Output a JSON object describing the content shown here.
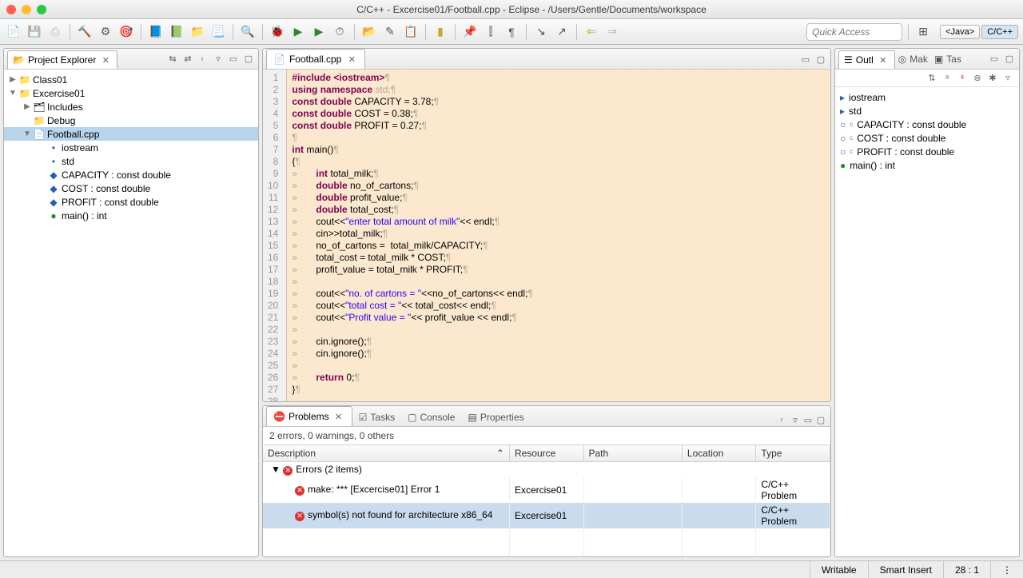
{
  "window": {
    "title": "C/C++ - Excercise01/Football.cpp - Eclipse - /Users/Gentle/Documents/workspace"
  },
  "quick_access": {
    "placeholder": "Quick Access"
  },
  "perspectives": {
    "java": "<Java>",
    "cpp": "C/C++"
  },
  "explorer": {
    "title": "Project Explorer",
    "items": [
      {
        "label": "Class01",
        "indent": 0,
        "arrow": "▶",
        "icon": "📁"
      },
      {
        "label": "Excercise01",
        "indent": 0,
        "arrow": "▼",
        "icon": "📁"
      },
      {
        "label": "Includes",
        "indent": 1,
        "arrow": "▶",
        "icon": "🗂"
      },
      {
        "label": "Debug",
        "indent": 1,
        "arrow": "",
        "icon": "📁"
      },
      {
        "label": "Football.cpp",
        "indent": 1,
        "arrow": "▼",
        "icon": "📄",
        "sel": true
      },
      {
        "label": "iostream",
        "indent": 2,
        "arrow": "",
        "icon": "•",
        "cls": "iblue"
      },
      {
        "label": "std",
        "indent": 2,
        "arrow": "",
        "icon": "•",
        "cls": "iblue"
      },
      {
        "label": "CAPACITY : const double",
        "indent": 2,
        "arrow": "",
        "icon": "◆",
        "cls": "iblue"
      },
      {
        "label": "COST : const double",
        "indent": 2,
        "arrow": "",
        "icon": "◆",
        "cls": "iblue"
      },
      {
        "label": "PROFIT : const double",
        "indent": 2,
        "arrow": "",
        "icon": "◆",
        "cls": "iblue"
      },
      {
        "label": "main() : int",
        "indent": 2,
        "arrow": "",
        "icon": "●",
        "cls": "igreen"
      }
    ]
  },
  "editor": {
    "tab": "Football.cpp",
    "lines": [
      [
        {
          "t": "#include",
          "c": "pp"
        },
        {
          "t": " ",
          "c": "ws"
        },
        {
          "t": "<iostream>",
          "c": "pp"
        },
        {
          "t": "¶",
          "c": "ws"
        }
      ],
      [
        {
          "t": "using",
          "c": "k"
        },
        {
          "t": " ",
          "c": "ws"
        },
        {
          "t": "namespace",
          "c": "k"
        },
        {
          "t": " std;¶",
          "c": "ws",
          "p": " std;"
        }
      ],
      [
        {
          "t": "const",
          "c": "k"
        },
        {
          "t": " ",
          "c": "ws"
        },
        {
          "t": "double",
          "c": "k"
        },
        {
          "t": " CAPACITY = 3.78;"
        },
        {
          "t": "¶",
          "c": "ws"
        }
      ],
      [
        {
          "t": "const",
          "c": "k"
        },
        {
          "t": " ",
          "c": "ws"
        },
        {
          "t": "double",
          "c": "k"
        },
        {
          "t": " COST = 0.38;"
        },
        {
          "t": "¶",
          "c": "ws"
        }
      ],
      [
        {
          "t": "const",
          "c": "k"
        },
        {
          "t": " ",
          "c": "ws"
        },
        {
          "t": "double",
          "c": "k"
        },
        {
          "t": " PROFIT = 0.27;"
        },
        {
          "t": "¶",
          "c": "ws"
        }
      ],
      [
        {
          "t": "¶",
          "c": "ws"
        }
      ],
      [
        {
          "t": "int",
          "c": "k"
        },
        {
          "t": " main()"
        },
        {
          "t": "¶",
          "c": "ws"
        }
      ],
      [
        {
          "t": "{"
        },
        {
          "t": "¶",
          "c": "ws"
        }
      ],
      [
        {
          "t": "»       ",
          "c": "ws"
        },
        {
          "t": "int",
          "c": "k"
        },
        {
          "t": " total_milk;"
        },
        {
          "t": "¶",
          "c": "ws"
        }
      ],
      [
        {
          "t": "»       ",
          "c": "ws"
        },
        {
          "t": "double",
          "c": "k"
        },
        {
          "t": " no_of_cartons;"
        },
        {
          "t": "¶",
          "c": "ws"
        }
      ],
      [
        {
          "t": "»       ",
          "c": "ws"
        },
        {
          "t": "double",
          "c": "k"
        },
        {
          "t": " profit_value;"
        },
        {
          "t": "¶",
          "c": "ws"
        }
      ],
      [
        {
          "t": "»       ",
          "c": "ws"
        },
        {
          "t": "double",
          "c": "k"
        },
        {
          "t": " total_cost;"
        },
        {
          "t": "¶",
          "c": "ws"
        }
      ],
      [
        {
          "t": "»       ",
          "c": "ws"
        },
        {
          "t": "cout<<"
        },
        {
          "t": "\"enter total amount of milk\"",
          "c": "s"
        },
        {
          "t": "<< endl;"
        },
        {
          "t": "¶",
          "c": "ws"
        }
      ],
      [
        {
          "t": "»       ",
          "c": "ws"
        },
        {
          "t": "cin>>total_milk;"
        },
        {
          "t": "¶",
          "c": "ws"
        }
      ],
      [
        {
          "t": "»       ",
          "c": "ws"
        },
        {
          "t": "no_of_cartons =  total_milk/CAPACITY;"
        },
        {
          "t": "¶",
          "c": "ws"
        }
      ],
      [
        {
          "t": "»       ",
          "c": "ws"
        },
        {
          "t": "total_cost = total_milk * COST;"
        },
        {
          "t": "¶",
          "c": "ws"
        }
      ],
      [
        {
          "t": "»       ",
          "c": "ws"
        },
        {
          "t": "profit_value = total_milk * PROFIT;"
        },
        {
          "t": "¶",
          "c": "ws"
        }
      ],
      [
        {
          "t": "»",
          "c": "ws"
        }
      ],
      [
        {
          "t": "»       ",
          "c": "ws"
        },
        {
          "t": "cout<<"
        },
        {
          "t": "\"no. of cartons = \"",
          "c": "s"
        },
        {
          "t": "<<no_of_cartons<< endl;"
        },
        {
          "t": "¶",
          "c": "ws"
        }
      ],
      [
        {
          "t": "»       ",
          "c": "ws"
        },
        {
          "t": "cout<<"
        },
        {
          "t": "\"total cost = \"",
          "c": "s"
        },
        {
          "t": "<< total_cost<< endl;"
        },
        {
          "t": "¶",
          "c": "ws"
        }
      ],
      [
        {
          "t": "»       ",
          "c": "ws"
        },
        {
          "t": "cout<<"
        },
        {
          "t": "\"Profit value = \"",
          "c": "s"
        },
        {
          "t": "<< profit_value << endl;"
        },
        {
          "t": "¶",
          "c": "ws"
        }
      ],
      [
        {
          "t": "»",
          "c": "ws"
        }
      ],
      [
        {
          "t": "»       ",
          "c": "ws"
        },
        {
          "t": "cin.ignore();"
        },
        {
          "t": "¶",
          "c": "ws"
        }
      ],
      [
        {
          "t": "»       ",
          "c": "ws"
        },
        {
          "t": "cin.ignore();"
        },
        {
          "t": "¶",
          "c": "ws"
        }
      ],
      [
        {
          "t": "»",
          "c": "ws"
        }
      ],
      [
        {
          "t": "»       ",
          "c": "ws"
        },
        {
          "t": "return",
          "c": "k"
        },
        {
          "t": " 0;"
        },
        {
          "t": "¶",
          "c": "ws"
        }
      ],
      [
        {
          "t": "}"
        },
        {
          "t": "¶",
          "c": "ws"
        }
      ],
      [
        {
          "t": ""
        }
      ]
    ]
  },
  "outline": {
    "title": "Outl",
    "tabs": [
      "Mak",
      "Tas"
    ],
    "items": [
      {
        "icon": "▸",
        "cls": "iblue",
        "label": "iostream"
      },
      {
        "icon": "▸",
        "cls": "iblue",
        "label": "std"
      },
      {
        "icon": "○",
        "cls": "iblue",
        "label": "CAPACITY : const double",
        "sup": "c"
      },
      {
        "icon": "○",
        "cls": "iblue",
        "label": "COST : const double",
        "sup": "c"
      },
      {
        "icon": "○",
        "cls": "iblue",
        "label": "PROFIT : const double",
        "sup": "c"
      },
      {
        "icon": "●",
        "cls": "igreen",
        "label": "main() : int"
      }
    ]
  },
  "problems": {
    "tabs": [
      "Problems",
      "Tasks",
      "Console",
      "Properties"
    ],
    "summary": "2 errors, 0 warnings, 0 others",
    "columns": [
      "Description",
      "Resource",
      "Path",
      "Location",
      "Type"
    ],
    "group": "Errors (2 items)",
    "rows": [
      {
        "desc": "make: *** [Excercise01] Error 1",
        "res": "Excercise01",
        "path": "",
        "loc": "",
        "type": "C/C++ Problem"
      },
      {
        "desc": "symbol(s) not found for architecture x86_64",
        "res": "Excercise01",
        "path": "",
        "loc": "",
        "type": "C/C++ Problem",
        "sel": true
      }
    ]
  },
  "status": {
    "writable": "Writable",
    "insert": "Smart Insert",
    "pos": "28 : 1"
  }
}
